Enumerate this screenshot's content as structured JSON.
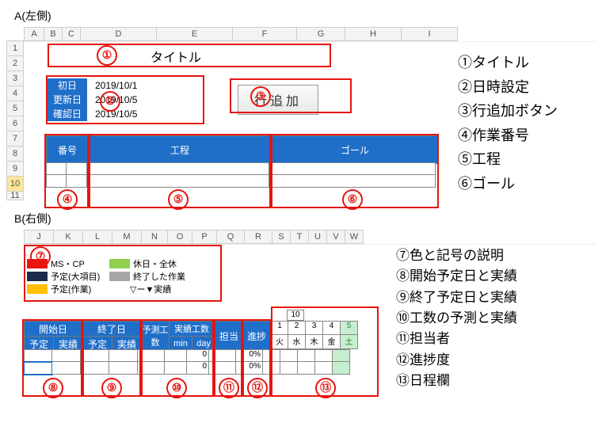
{
  "sectionA": {
    "label": "A(左側)",
    "cols": [
      "A",
      "B",
      "C",
      "D",
      "E",
      "F",
      "G",
      "H",
      "I"
    ],
    "rows": [
      "1",
      "2",
      "3",
      "4",
      "5",
      "6",
      "7",
      "8",
      "9",
      "10",
      "11"
    ],
    "title_text": "タイトル",
    "date_labels": [
      "初日",
      "更新日",
      "確認日"
    ],
    "date_values": [
      "2019/10/1",
      "2019/10/5",
      "2019/10/5"
    ],
    "button_label": "行追加",
    "table_headers": [
      "番号",
      "工程",
      "ゴール"
    ],
    "markers": {
      "m1": "①",
      "m2": "②",
      "m3": "③",
      "m4": "④",
      "m5": "⑤",
      "m6": "⑥"
    }
  },
  "sectionB": {
    "label": "B(右側)",
    "cols": [
      "J",
      "K",
      "L",
      "M",
      "N",
      "O",
      "P",
      "Q",
      "R",
      "S",
      "T",
      "U",
      "V",
      "W"
    ],
    "legend": {
      "r1a": "MS・CP",
      "r1b": "休日・全休",
      "r2a": "予定(大項目)",
      "r2b": "終了した作業",
      "r3a": "予定(作業)",
      "r3b": "▽ー▼実績"
    },
    "headers": {
      "start": "開始日",
      "end": "終了日",
      "yotei": "予定",
      "jisseki": "実績",
      "yosoku": "予測工数",
      "jissekikousu": "実績工数",
      "min": "min",
      "day": "day",
      "tantou": "担当",
      "shinchoku": "進捗"
    },
    "calendar": {
      "month": "10",
      "days": [
        "1",
        "2",
        "3",
        "4",
        "5"
      ],
      "wdays": [
        "火",
        "水",
        "木",
        "金",
        "土"
      ]
    },
    "progress": [
      "0%",
      "0%"
    ],
    "zeros": [
      "0",
      "0"
    ],
    "markers": {
      "m7": "⑦",
      "m8": "⑧",
      "m9": "⑨",
      "m10": "⑩",
      "m11": "⑪",
      "m12": "⑫",
      "m13": "⑬"
    }
  },
  "rightList1": {
    "i1": "①タイトル",
    "i2": "②日時設定",
    "i3": "③行追加ボタン",
    "i4": "④作業番号",
    "i5": "⑤工程",
    "i6": "⑥ゴール"
  },
  "rightList2": {
    "i7": "⑦色と記号の説明",
    "i8": "⑧開始予定日と実績",
    "i9": "⑨終了予定日と実績",
    "i10": "⑩工数の予測と実績",
    "i11": "⑪担当者",
    "i12": "⑫進捗度",
    "i13": "⑬日程欄"
  }
}
